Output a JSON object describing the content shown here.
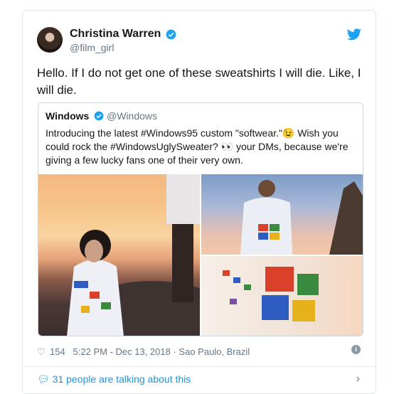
{
  "author": {
    "name": "Christina Warren",
    "handle": "@film_girl"
  },
  "tweet": {
    "text": "Hello. If I do not get one of these sweatshirts I will die. Like, I will die."
  },
  "quoted": {
    "name": "Windows",
    "handle": "@Windows",
    "text": "Introducing the latest #Windows95 custom \"softwear.\"😉 Wish you could rock the #WindowsUglySweater? 👀 your DMs, because we're giving a few lucky fans one of their very own."
  },
  "meta": {
    "likes": "154",
    "timestamp": "5:22 PM - Dec 13, 2018",
    "location": "Sao Paulo, Brazil"
  },
  "footer": {
    "talking": "31 people are talking about this"
  },
  "colors": {
    "link": "#1b95e0",
    "verified": "#1da1f2",
    "muted": "#657786"
  }
}
